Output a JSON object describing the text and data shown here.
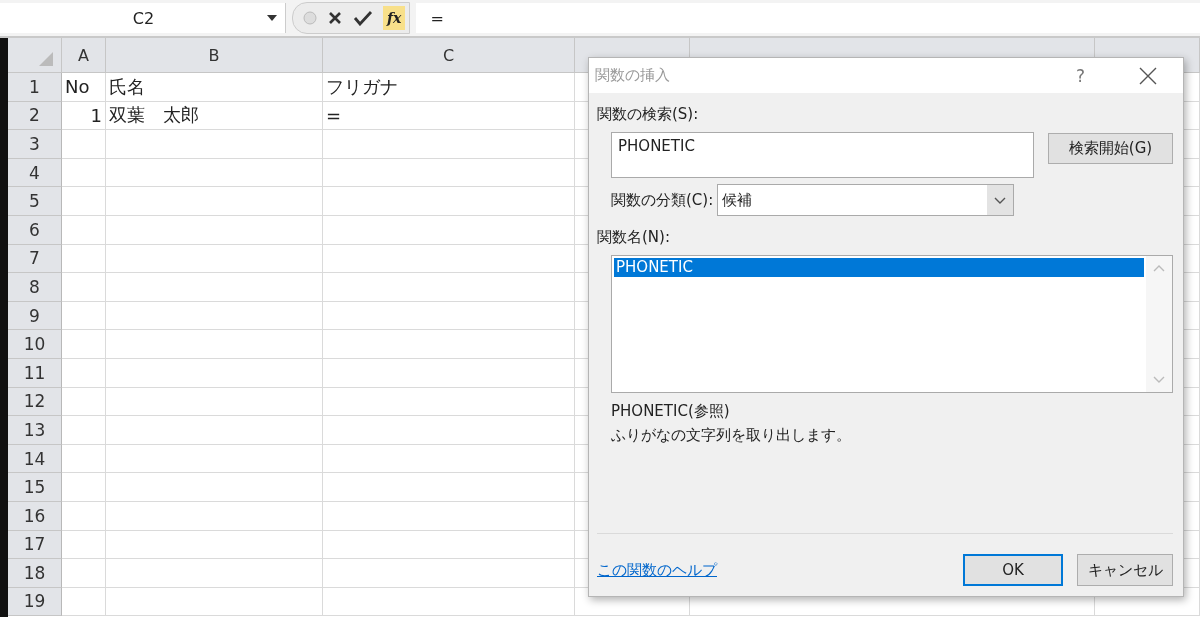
{
  "formula_bar": {
    "name_box": "C2",
    "function_button": "fx",
    "formula": "="
  },
  "sheet": {
    "columns": [
      {
        "label": "A"
      },
      {
        "label": "B"
      },
      {
        "label": "C"
      },
      {},
      {},
      {}
    ],
    "rows": [
      {
        "number": "1",
        "cells": [
          {
            "text": "No",
            "numeric": false
          },
          {
            "text": "氏名",
            "numeric": false
          },
          {
            "text": "フリガナ",
            "numeric": false
          }
        ]
      },
      {
        "number": "2",
        "cells": [
          {
            "text": "1",
            "numeric": true
          },
          {
            "text": "双葉　太郎",
            "numeric": false
          },
          {
            "text": "=",
            "numeric": false
          }
        ]
      },
      {
        "number": "3"
      },
      {
        "number": "4"
      },
      {
        "number": "5"
      },
      {
        "number": "6"
      },
      {
        "number": "7"
      },
      {
        "number": "8"
      },
      {
        "number": "9"
      },
      {
        "number": "10"
      },
      {
        "number": "11"
      },
      {
        "number": "12"
      },
      {
        "number": "13"
      },
      {
        "number": "14"
      },
      {
        "number": "15"
      },
      {
        "number": "16"
      },
      {
        "number": "17"
      },
      {
        "number": "18"
      },
      {
        "number": "19"
      }
    ]
  },
  "dialog": {
    "title": "関数の挿入",
    "help": "?",
    "search_label": "関数の検索(S):",
    "search_value": "PHONETIC",
    "search_button": "検索開始(G)",
    "category_label": "関数の分類(C):",
    "category_value": "候補",
    "list_label": "関数名(N):",
    "functions": [
      {
        "name": "PHONETIC",
        "selected": true
      }
    ],
    "signature": "PHONETIC(参照)",
    "description": "ふりがなの文字列を取り出します。",
    "help_link": "この関数のヘルプ",
    "ok": "OK",
    "cancel": "キャンセル"
  }
}
